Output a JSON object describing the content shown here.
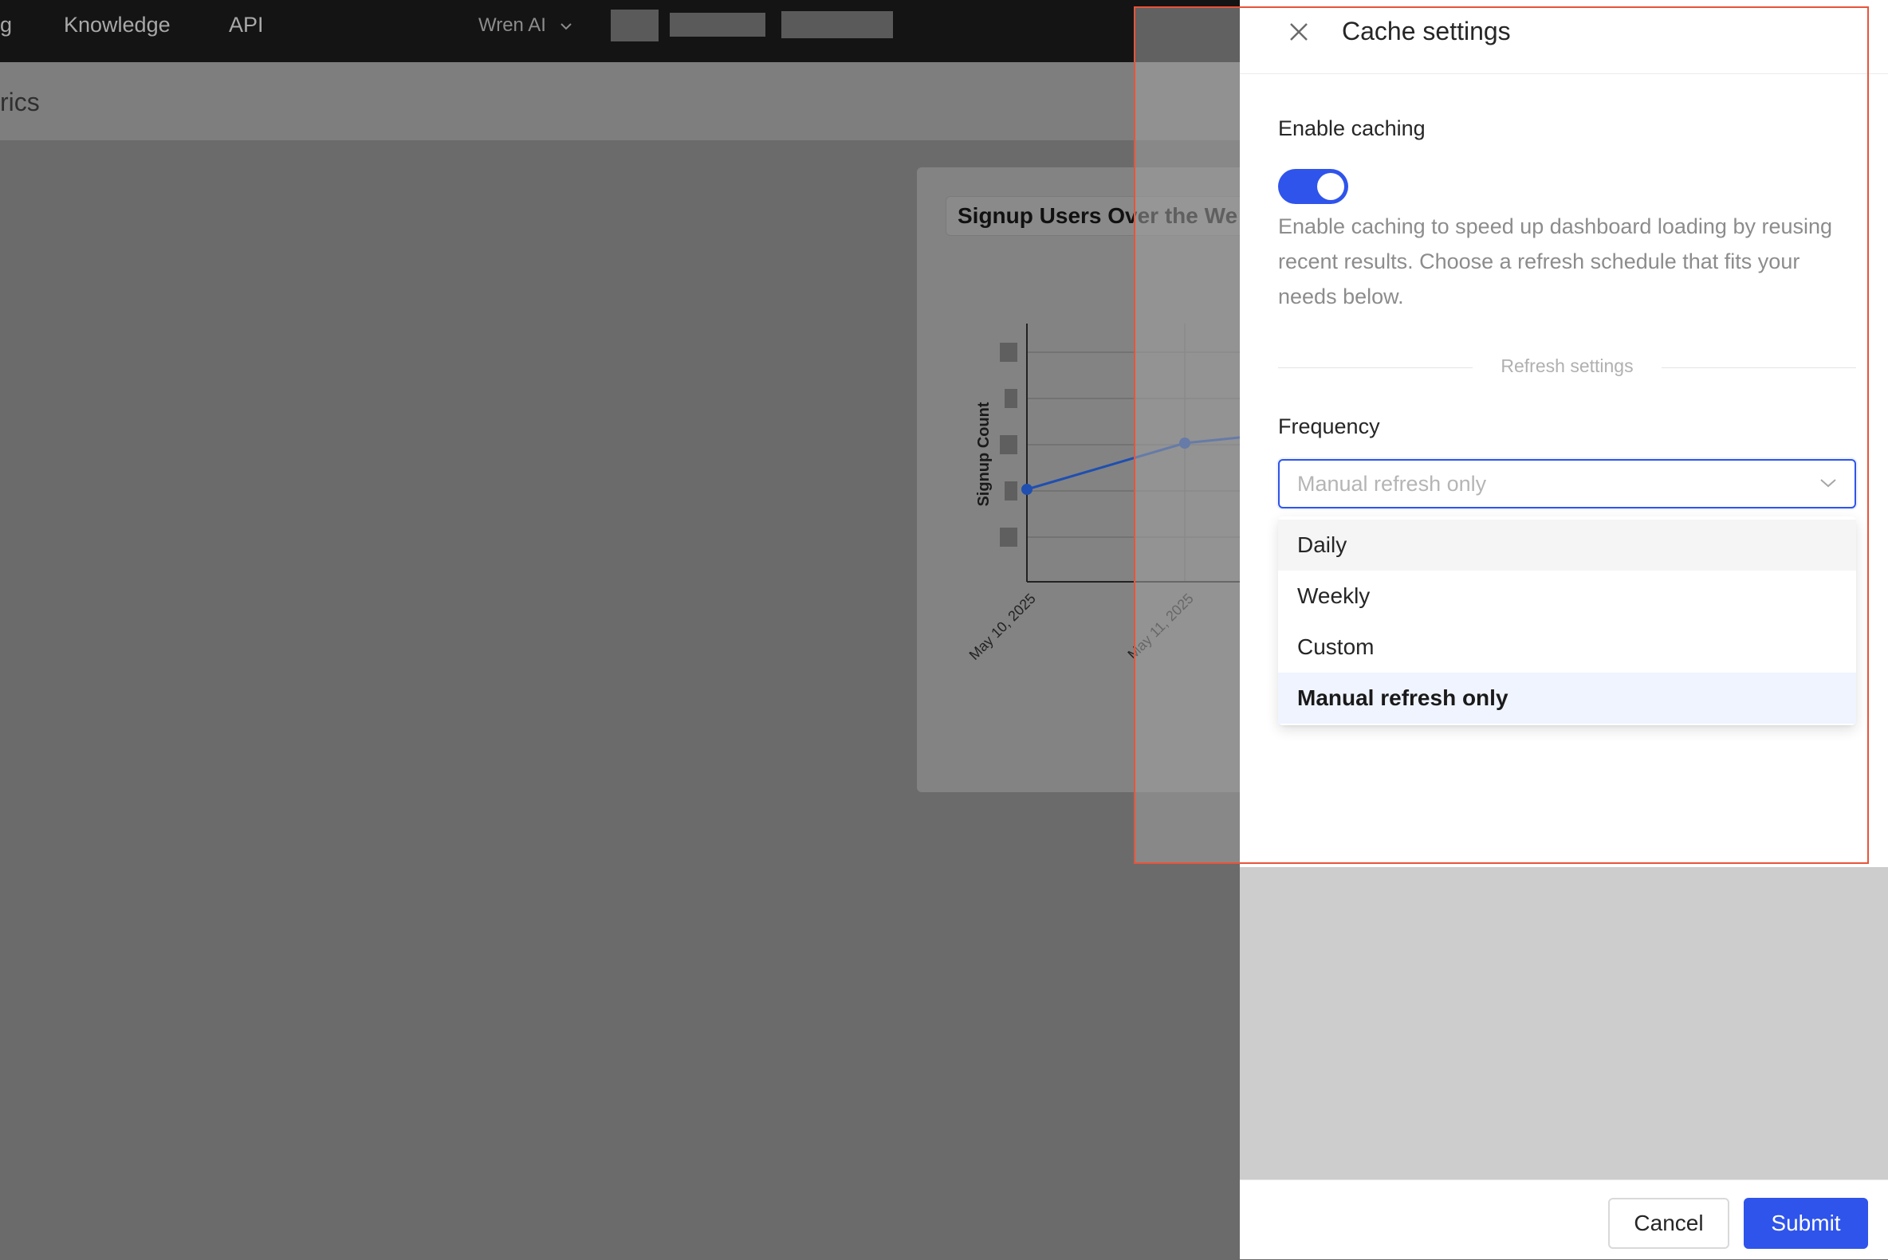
{
  "topbar": {
    "nav_items": [
      "g",
      "Knowledge",
      "API"
    ],
    "project_label": "Wren AI"
  },
  "page": {
    "title_fragment": "rics"
  },
  "chart": {
    "title": "Signup Users Over the We"
  },
  "chart_data": {
    "type": "line",
    "title": "Signup Users Over the We",
    "ylabel": "Signup Count",
    "x": [
      "May 10, 2025",
      "May 11, 2025"
    ],
    "series": [
      {
        "values": [
          1,
          2
        ]
      }
    ],
    "grid": true,
    "line_color": "#1f4fb0"
  },
  "drawer": {
    "title": "Cache settings",
    "enable_label": "Enable caching",
    "enabled": true,
    "description": "Enable caching to speed up dashboard loading by reusing recent results. Choose a refresh schedule that fits your needs below.",
    "divider_text": "Refresh settings",
    "frequency_label": "Frequency",
    "select_placeholder": "Manual refresh only",
    "options": [
      "Daily",
      "Weekly",
      "Custom",
      "Manual refresh only"
    ],
    "selected_option": "Manual refresh only",
    "cancel_label": "Cancel",
    "submit_label": "Submit",
    "accent_color": "#2f54eb",
    "highlight_color": "#e8543a"
  },
  "icons": {
    "close": "close-icon",
    "select_arrow": "chevron-down-icon",
    "project_arrow": "chevron-down-icon"
  }
}
